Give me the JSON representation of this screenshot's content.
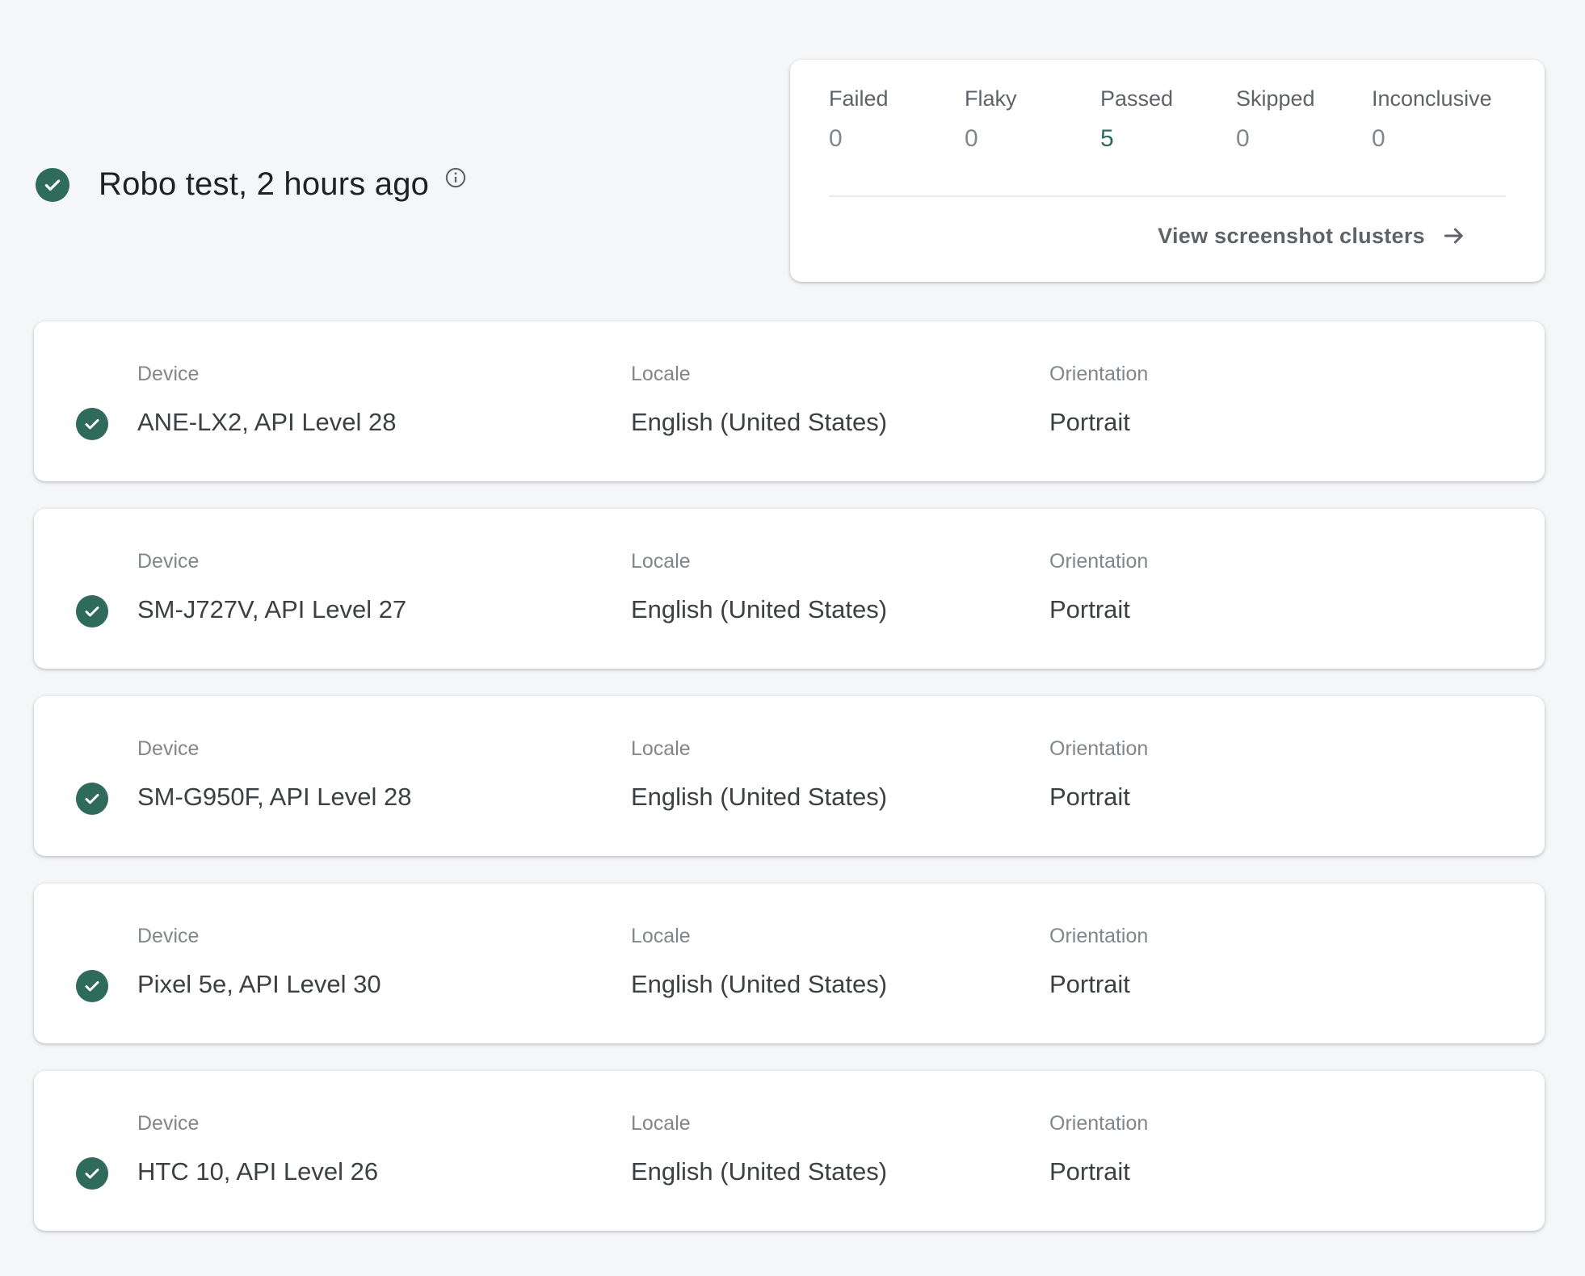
{
  "header": {
    "title": "Robo test, 2 hours ago",
    "status_icon": "check-circle-icon",
    "info_icon": "info-icon"
  },
  "summary": {
    "stats": [
      {
        "label": "Failed",
        "value": "0"
      },
      {
        "label": "Flaky",
        "value": "0"
      },
      {
        "label": "Passed",
        "value": "5"
      },
      {
        "label": "Skipped",
        "value": "0"
      },
      {
        "label": "Inconclusive",
        "value": "0"
      }
    ],
    "link_label": "View screenshot clusters",
    "link_icon": "arrow-right-icon"
  },
  "labels": {
    "device": "Device",
    "locale": "Locale",
    "orientation": "Orientation"
  },
  "devices": [
    {
      "device": "ANE-LX2, API Level 28",
      "locale": "English (United States)",
      "orientation": "Portrait"
    },
    {
      "device": "SM-J727V, API Level 27",
      "locale": "English (United States)",
      "orientation": "Portrait"
    },
    {
      "device": "SM-G950F, API Level 28",
      "locale": "English (United States)",
      "orientation": "Portrait"
    },
    {
      "device": "Pixel 5e, API Level 30",
      "locale": "English (United States)",
      "orientation": "Portrait"
    },
    {
      "device": "HTC 10, API Level 26",
      "locale": "English (United States)",
      "orientation": "Portrait"
    }
  ],
  "colors": {
    "accent": "#2e6b5b",
    "background": "#f5f6f8",
    "card": "#ffffff"
  }
}
